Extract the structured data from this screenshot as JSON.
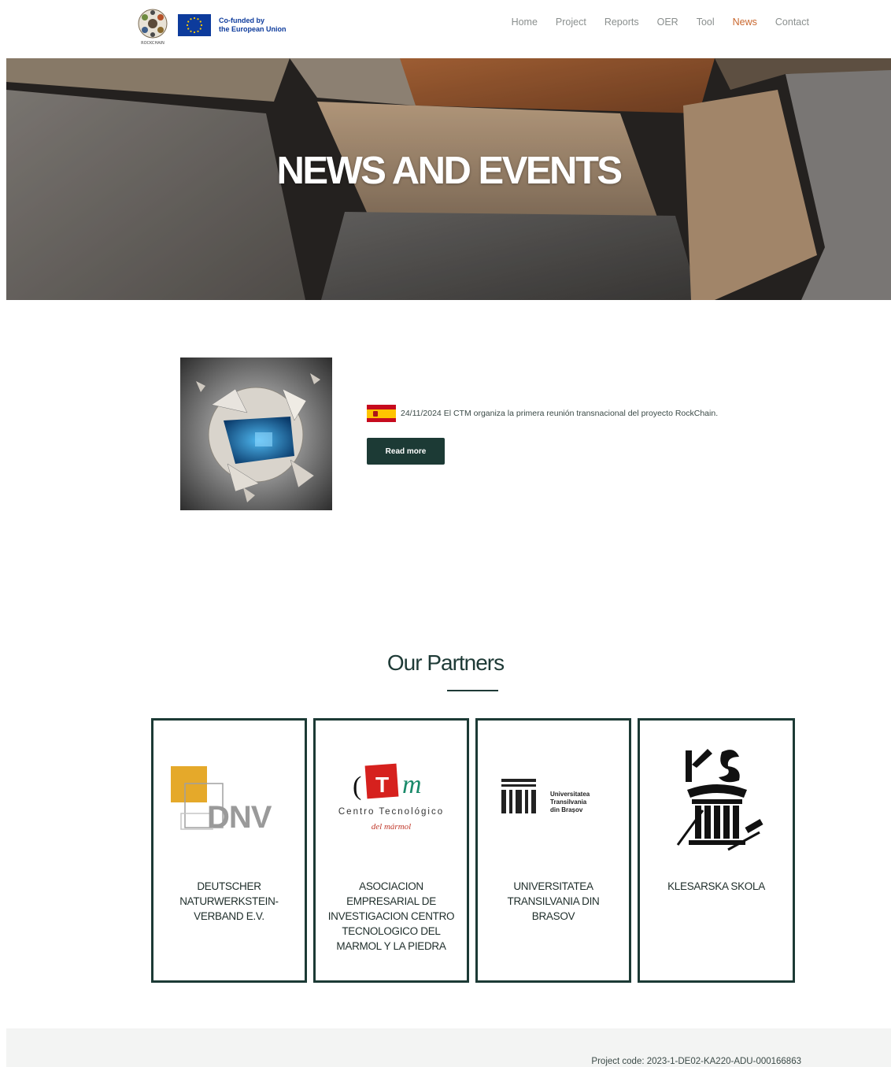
{
  "header": {
    "eu_text_line1": "Co-funded by",
    "eu_text_line2": "the European Union",
    "logo_caption": "ROCKCHAIN",
    "nav": [
      {
        "label": "Home",
        "active": false
      },
      {
        "label": "Project",
        "active": false
      },
      {
        "label": "Reports",
        "active": false
      },
      {
        "label": "OER",
        "active": false
      },
      {
        "label": "Tool",
        "active": false
      },
      {
        "label": "News",
        "active": true
      },
      {
        "label": "Contact",
        "active": false
      }
    ],
    "active_color": "#c9672e"
  },
  "hero": {
    "title": "NEWS AND EVENTS"
  },
  "news": {
    "flag": "spain-flag-icon",
    "text": "24/11/2024 El CTM organiza la primera reunión transnacional del proyecto RockChain.",
    "button_label": "Read more"
  },
  "partners": {
    "title": "Our Partners",
    "items": [
      {
        "name": "DEUTSCHER NATURWERKSTEIN-VERBAND E.V.",
        "logo_text": "DNV"
      },
      {
        "name": "ASOCIACION EMPRESARIAL DE INVESTIGACION CENTRO TECNOLOGICO DEL MARMOL Y LA PIEDRA",
        "logo_text1": "Centro Tecnológico",
        "logo_text2": "del mármol"
      },
      {
        "name": "UNIVERSITATEA TRANSILVANIA DIN BRASOV",
        "logo_text1": "Universitatea",
        "logo_text2": "Transilvania",
        "logo_text3": "din Brașov"
      },
      {
        "name": "KLESARSKA SKOLA"
      }
    ]
  },
  "footer": {
    "project_code": "Project code: 2023-1-DE02-KA220-ADU-000166863"
  },
  "colors": {
    "primary_dark": "#1c3a35",
    "accent": "#c9672e",
    "eu_blue": "#0d3b9c"
  }
}
